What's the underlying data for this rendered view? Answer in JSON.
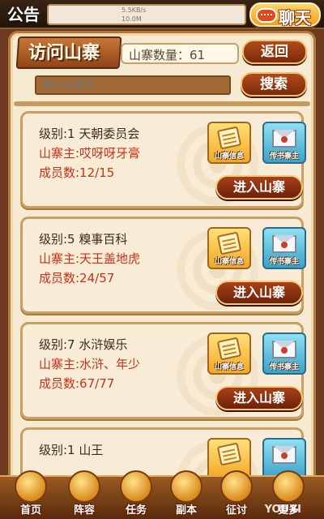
{
  "topbar": {
    "notice_label": "公告",
    "net_speed": "5.5KB/s",
    "net_size": "10.0M",
    "chat_label": "聊天"
  },
  "header": {
    "title": "访问山寨",
    "count_text": "山寨数量：61",
    "back_label": "返回"
  },
  "search": {
    "placeholder": "输入山寨名",
    "button_label": "搜索"
  },
  "card_buttons": {
    "info_label": "山寨信息",
    "mail_label": "传书寨主",
    "enter_label": "进入山寨"
  },
  "strongholds": [
    {
      "level": "级别:1 天朝委员会",
      "owner": "山寨主:哎呀呀牙膏",
      "members": "成员数:12/15"
    },
    {
      "level": "级别:5 糗事百科",
      "owner": "山寨主:天王盖地虎",
      "members": "成员数:24/57"
    },
    {
      "level": "级别:7 水浒娱乐",
      "owner": "山寨主:水浒、年少",
      "members": "成员数:67/77"
    },
    {
      "level": "级别:1 山王",
      "owner": "",
      "members": ""
    }
  ],
  "nav": {
    "items": [
      {
        "label": "首页",
        "icon": "home-icon"
      },
      {
        "label": "阵容",
        "icon": "lineup-icon"
      },
      {
        "label": "任务",
        "icon": "task-icon"
      },
      {
        "label": "副本",
        "icon": "dungeon-icon"
      },
      {
        "label": "征讨",
        "icon": "attack-icon"
      },
      {
        "label": "更多",
        "icon": "more-icon"
      }
    ]
  },
  "watermark": "YOUXI"
}
